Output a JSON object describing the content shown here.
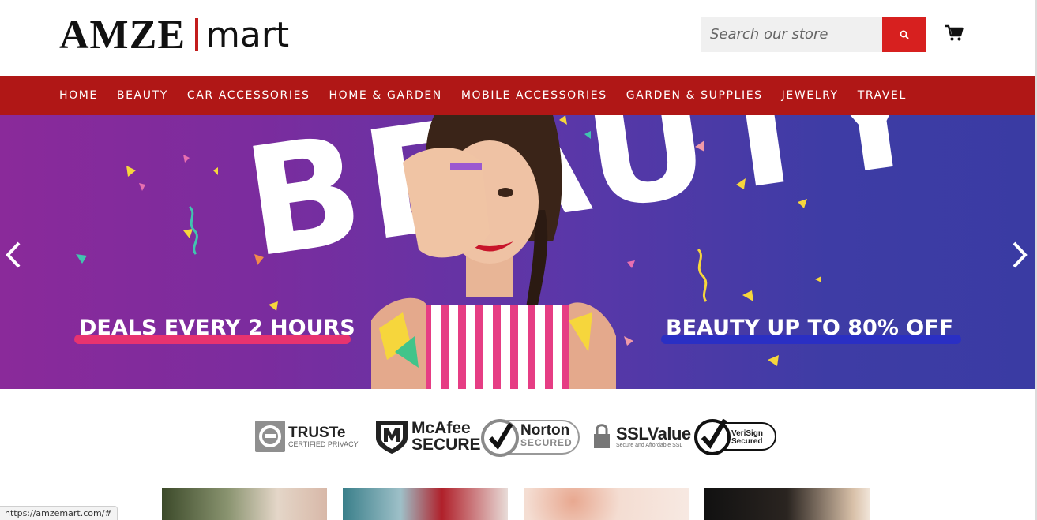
{
  "header": {
    "logo_main": "AMZE",
    "logo_sub": "mart",
    "search_placeholder": "Search our store",
    "accent_color": "#d7201f"
  },
  "nav": {
    "items": [
      "HOME",
      "BEAUTY",
      "CAR ACCESSORIES",
      "HOME & GARDEN",
      "MOBILE ACCESSORIES",
      "GARDEN & SUPPLIES",
      "JEWELRY",
      "TRAVEL"
    ],
    "background": "#b01716"
  },
  "hero": {
    "headline": "BEAUTY",
    "left_deal": "DEALS EVERY 2 HOURS",
    "right_deal": "BEAUTY UP TO 80% OFF"
  },
  "badges": {
    "truste": {
      "title": "TRUSTe",
      "sub": "CERTIFIED PRIVACY"
    },
    "mcafee": {
      "title": "McAfee",
      "sub": "SECURE"
    },
    "norton": {
      "title": "Norton",
      "sub": "SECURED"
    },
    "sslvalue": {
      "title": "SSLValue",
      "sub": "Secure and Affordable SSL"
    },
    "verisign": {
      "title": "VeriSign",
      "sub": "Secured"
    }
  },
  "status_bar": {
    "url": "https://amzemart.com/#"
  }
}
